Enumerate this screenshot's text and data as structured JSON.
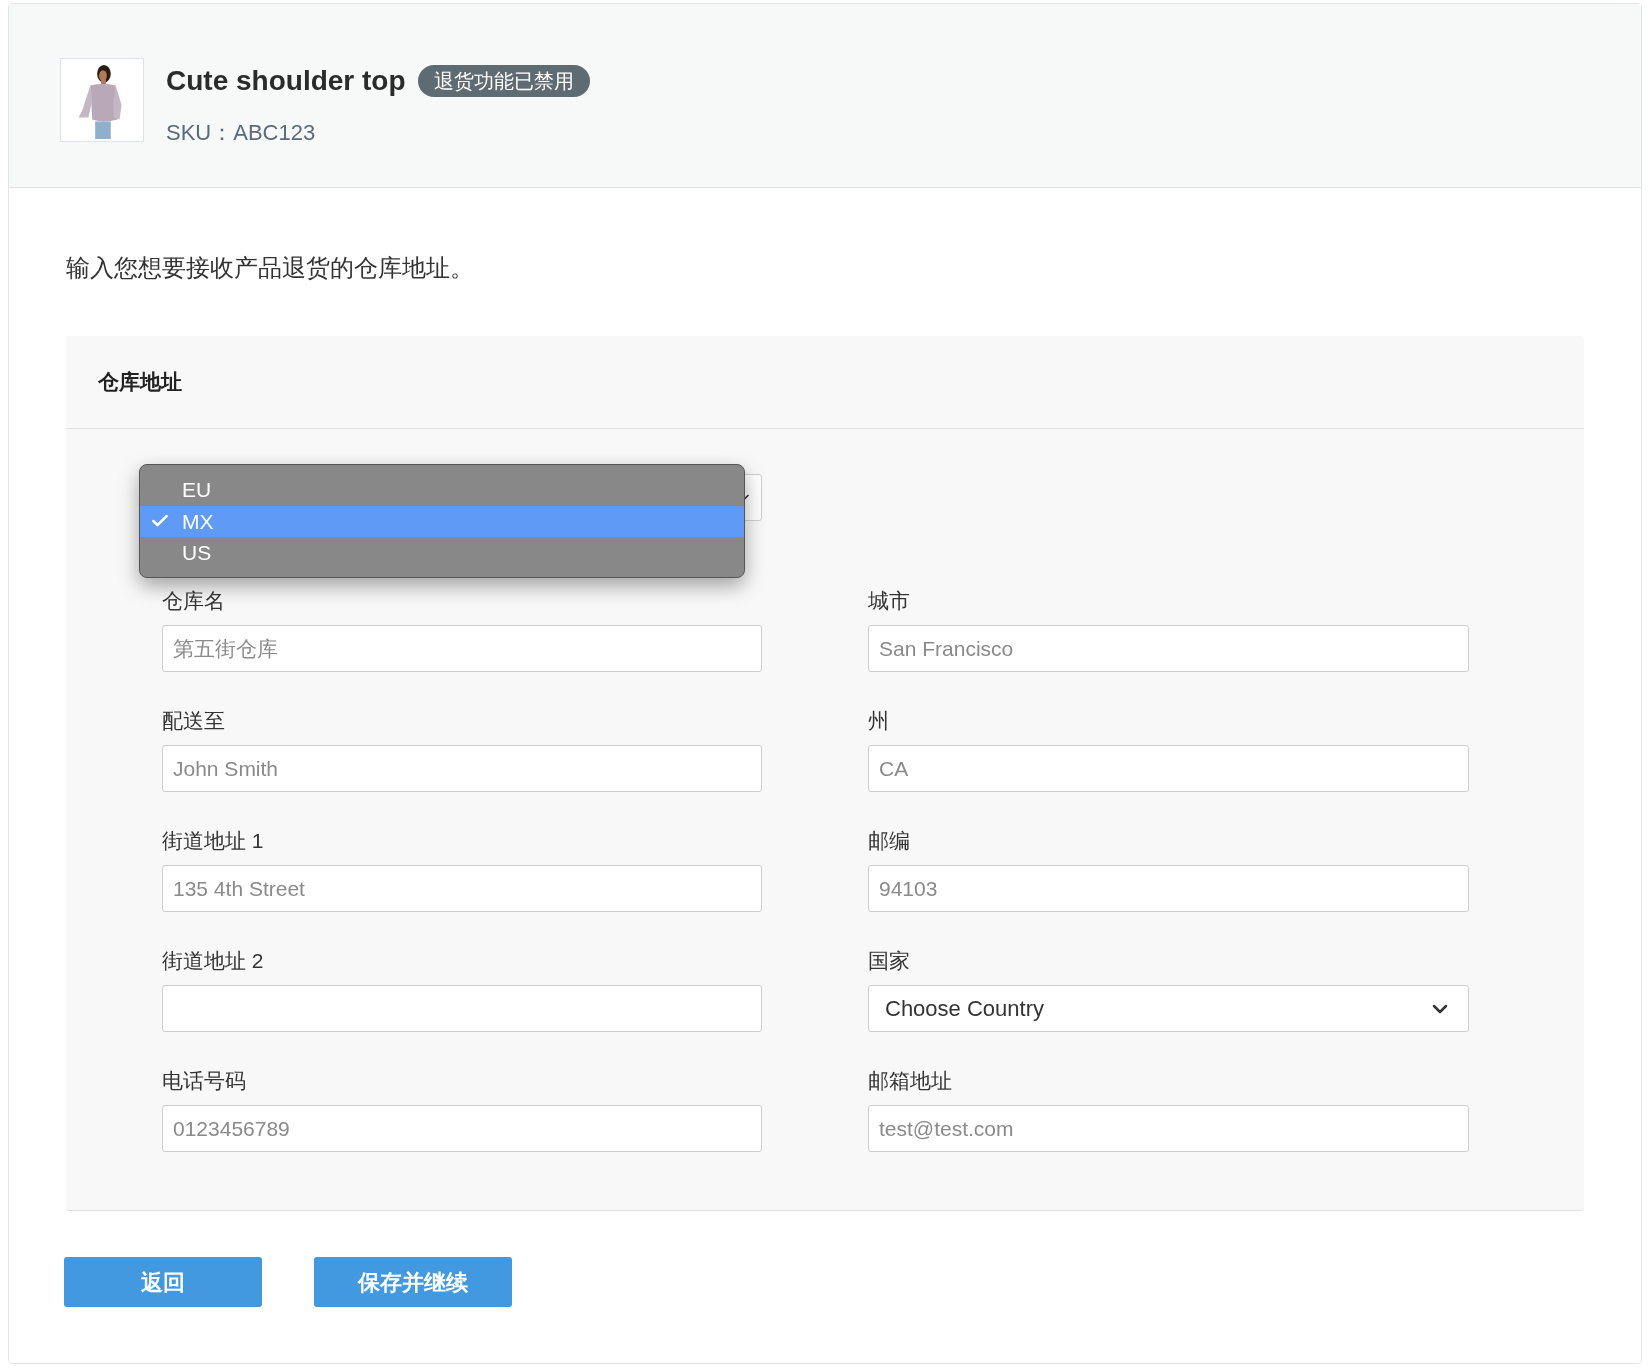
{
  "product": {
    "title": "Cute shoulder top",
    "badge": "退货功能已禁用",
    "sku": "SKU：ABC123"
  },
  "instruction": "输入您想要接收产品退货的仓库地址。",
  "panel": {
    "title": "仓库地址",
    "region_menu": {
      "options": [
        {
          "label": "EU",
          "selected": false
        },
        {
          "label": "MX",
          "selected": true
        },
        {
          "label": "US",
          "selected": false
        }
      ]
    },
    "fields": [
      {
        "label": "仓库名",
        "placeholder": "第五街仓库"
      },
      {
        "label": "城市",
        "placeholder": "San Francisco"
      },
      {
        "label": "配送至",
        "placeholder": "John Smith"
      },
      {
        "label": "州",
        "placeholder": "CA"
      },
      {
        "label": "街道地址 1",
        "placeholder": "135 4th Street"
      },
      {
        "label": "邮编",
        "placeholder": "94103"
      },
      {
        "label": "街道地址 2"
      },
      {
        "label": "国家",
        "kind": "select",
        "value": "Choose Country"
      },
      {
        "label": "电话号码",
        "placeholder": "0123456789"
      },
      {
        "label": "邮箱地址",
        "placeholder": "test@test.com"
      }
    ]
  },
  "buttons": [
    {
      "label": "返回"
    },
    {
      "label": "保存并继续"
    }
  ]
}
